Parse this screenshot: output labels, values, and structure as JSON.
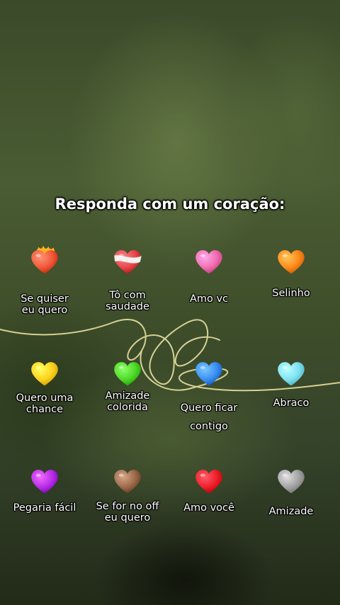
{
  "title": "Responda com um coração:",
  "hearts": [
    {
      "name": "heart-on-fire-icon",
      "icon": "heart-on-fire",
      "color": "#f2583a",
      "lines": [
        "Se quiser",
        "eu quero"
      ]
    },
    {
      "name": "mending-heart-icon",
      "icon": "mending-heart",
      "color": "#e8474c",
      "lines": [
        "Tô com",
        "saudade"
      ]
    },
    {
      "name": "pink-heart-icon",
      "icon": "pink-heart",
      "color": "#f26db0",
      "lines": [
        "Amo vc"
      ]
    },
    {
      "name": "orange-heart-icon",
      "icon": "orange-heart",
      "color": "#ff8a1c",
      "lines": [
        "Selinho"
      ]
    },
    {
      "name": "yellow-heart-icon",
      "icon": "yellow-heart",
      "color": "#ffd21f",
      "lines": [
        "Quero uma",
        "chance"
      ]
    },
    {
      "name": "green-heart-icon",
      "icon": "green-heart",
      "color": "#4fd82a",
      "lines": [
        "Amizade",
        "colorida"
      ]
    },
    {
      "name": "blue-heart-icon",
      "icon": "blue-heart",
      "color": "#3b8df2",
      "lines": [
        "Quero ficar",
        "contigo"
      ]
    },
    {
      "name": "light-blue-heart-icon",
      "icon": "light-blue-heart",
      "color": "#7fe0f2",
      "lines": [
        "Abraco"
      ]
    },
    {
      "name": "purple-heart-icon",
      "icon": "purple-heart",
      "color": "#b62ee8",
      "lines": [
        "Pegaria fácil"
      ]
    },
    {
      "name": "brown-heart-icon",
      "icon": "brown-heart",
      "color": "#9a6a4b",
      "lines": [
        "Se for no off",
        "eu quero"
      ]
    },
    {
      "name": "red-heart-icon",
      "icon": "red-heart",
      "color": "#ee1f2c",
      "lines": [
        "Amo você"
      ]
    },
    {
      "name": "grey-heart-icon",
      "icon": "grey-heart",
      "color": "#a3a3a3",
      "lines": [
        "Amizade"
      ]
    }
  ]
}
